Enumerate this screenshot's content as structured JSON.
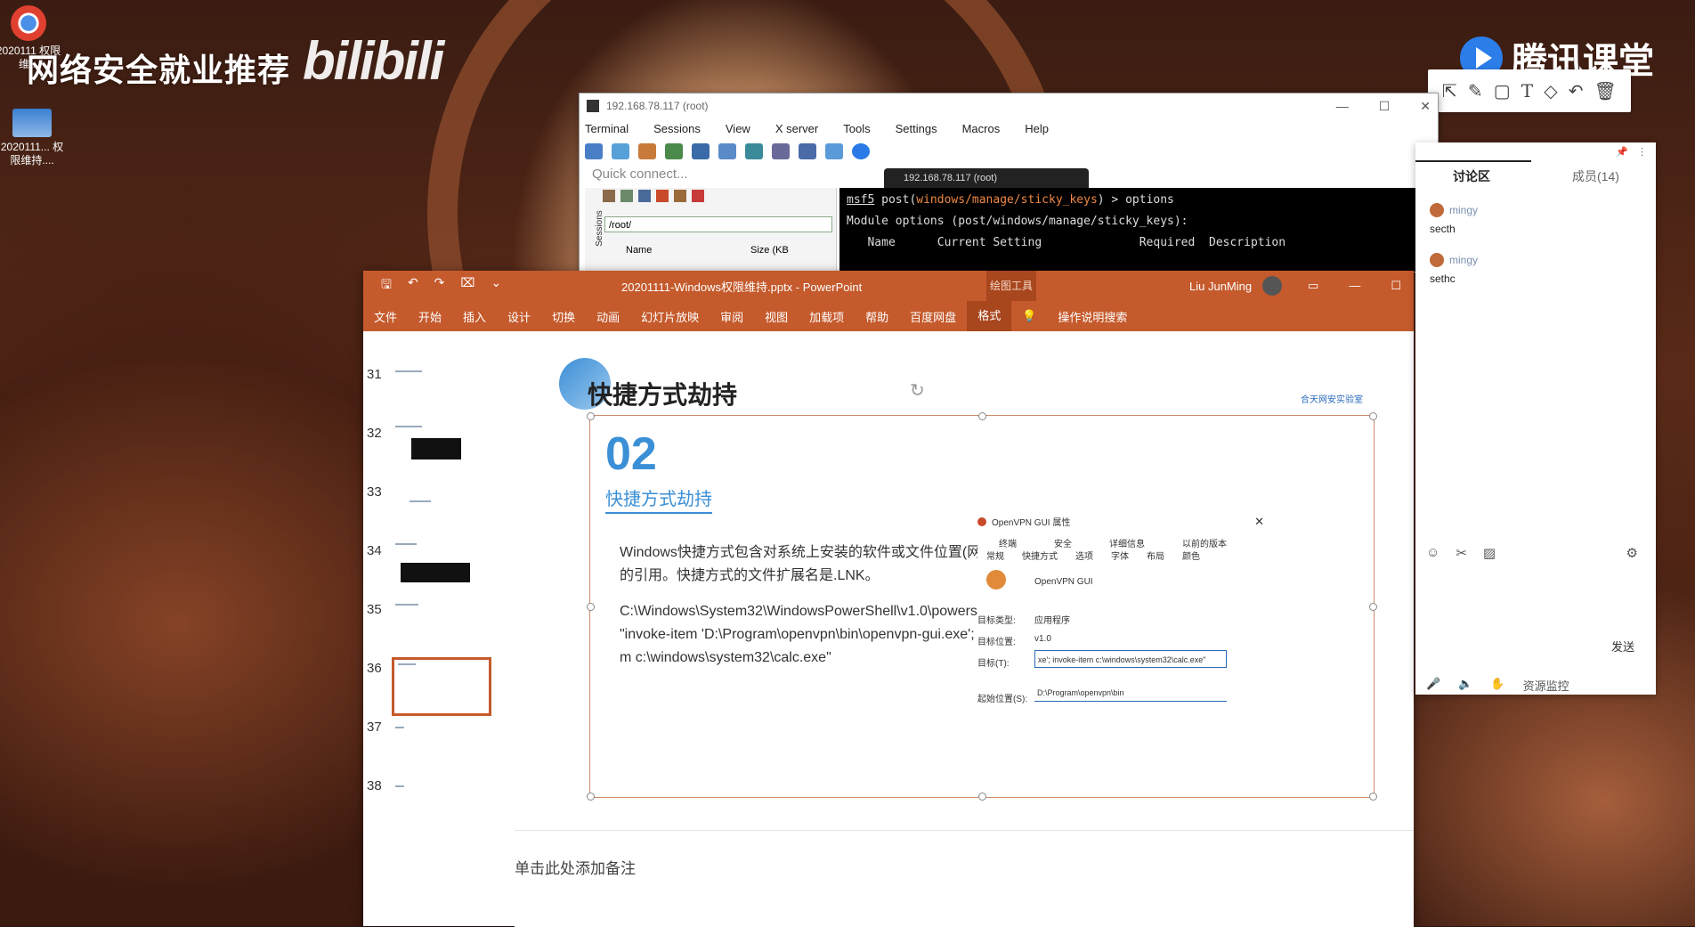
{
  "desktop": {
    "icons": [
      {
        "label": "2020111 权限维..."
      },
      {
        "label": "2020111... 权限维持...."
      }
    ],
    "watermark_left": "网络安全就业推荐",
    "watermark_bili": "bilibili",
    "watermark_right": "腾讯课堂"
  },
  "annotation_toolbar": {
    "tools": [
      "cursor-icon",
      "pen-icon",
      "rectangle-icon",
      "text-icon",
      "eraser-icon",
      "undo-icon",
      "trash-icon"
    ]
  },
  "mobaxterm": {
    "title": "192.168.78.117 (root)",
    "menu": [
      "Terminal",
      "Sessions",
      "View",
      "X server",
      "Tools",
      "Settings",
      "Macros",
      "Help"
    ],
    "quick_connect": "Quick connect...",
    "path": "/root/",
    "side_label": "Sessions",
    "file_header_name": "Name",
    "file_header_size": "Size (KB",
    "tab_label": "192.168.78.117 (root)",
    "terminal": {
      "line1_prompt": "msf5",
      "line1_post": " post(",
      "line1_module": "windows/manage/sticky_keys",
      "line1_rest": ") > options",
      "line2": "Module options (post/windows/manage/sticky_keys):",
      "header": "   Name      Current Setting              Required  Description"
    }
  },
  "powerpoint": {
    "filename": "20201111-Windows权限维持.pptx  -  PowerPoint",
    "context_tab": "绘图工具",
    "user": "Liu JunMing",
    "ribbon_tabs": [
      "文件",
      "开始",
      "插入",
      "设计",
      "切换",
      "动画",
      "幻灯片放映",
      "审阅",
      "视图",
      "加载项",
      "帮助",
      "百度网盘",
      "格式",
      "操作说明搜索"
    ],
    "active_tab": "格式",
    "thumbnails": [
      "31",
      "32",
      "33",
      "34",
      "35",
      "36",
      "37",
      "38"
    ],
    "selected_thumbnail": "36",
    "slide": {
      "title": "快捷方式劫持",
      "logo_text": "合天网安实验室",
      "number": "02",
      "subheading": "快捷方式劫持",
      "para1": "Windows快捷方式包含对系统上安装的软件或文件位置(网络或本地)的引用。快捷方式的文件扩展名是.LNK。",
      "para2": "C:\\Windows\\System32\\WindowsPowerShell\\v1.0\\powershell.exe -c \"invoke-item 'D:\\Program\\openvpn\\bin\\openvpn-gui.exe'; invoke-item c:\\windows\\system32\\calc.exe\"",
      "dialog": {
        "title": "OpenVPN GUI 属性",
        "tabs_row1": [
          "终端",
          "安全",
          "详细信息",
          "以前的版本"
        ],
        "tabs_row2": [
          "常规",
          "快捷方式",
          "选项",
          "字体",
          "布局",
          "颜色"
        ],
        "app_name": "OpenVPN GUI",
        "target_type_label": "目标类型:",
        "target_type_value": "应用程序",
        "target_loc_label": "目标位置:",
        "target_loc_value": "v1.0",
        "target_label": "目标(T):",
        "target_value": "xe'; invoke-item c:\\windows\\system32\\calc.exe\"",
        "start_label": "起始位置(S):",
        "start_value": "D:\\Program\\openvpn\\bin"
      }
    },
    "notes_placeholder": "单击此处添加备注"
  },
  "discussion": {
    "tab_discuss": "讨论区",
    "tab_members": "成员(14)",
    "messages": [
      {
        "user": "mingy",
        "text": "secth"
      },
      {
        "user": "mingy",
        "text": "sethc"
      }
    ],
    "send": "发送",
    "bottom_label": "资源监控"
  }
}
